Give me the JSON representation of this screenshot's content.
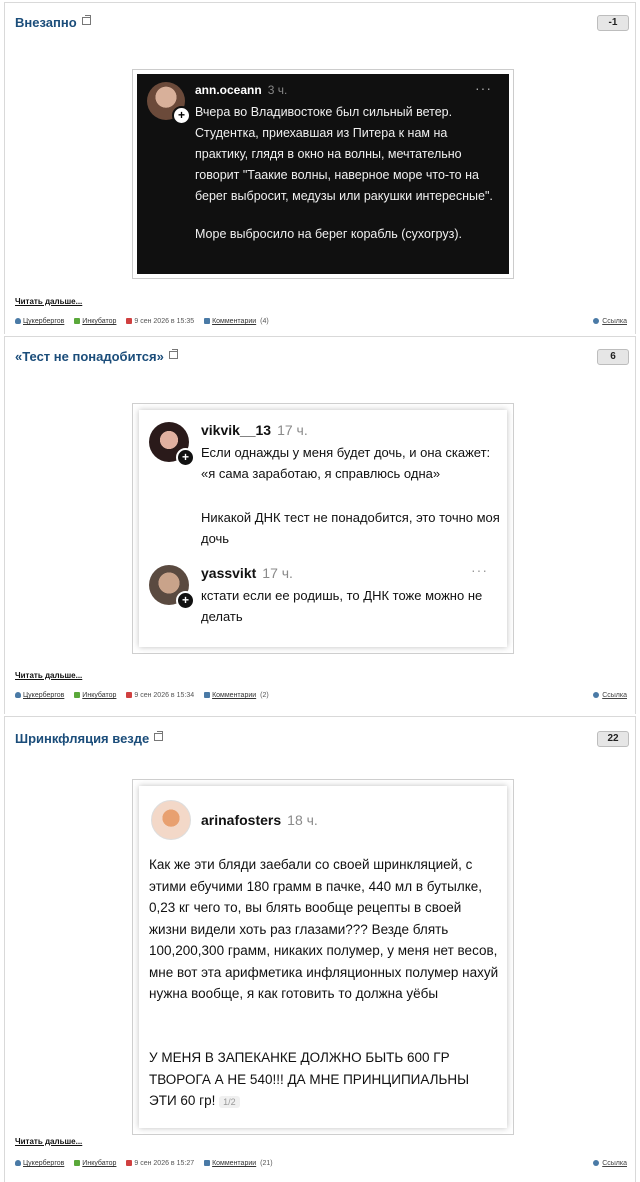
{
  "posts": [
    {
      "title": "Внезапно",
      "score": "-1",
      "comment": {
        "user": "ann.oceann",
        "time": "3 ч.",
        "dots": "···",
        "paragraph1": "Вчера во Владивостоке был сильный ветер. Студентка, приехавшая из Питера к нам на практику, глядя в окно на волны, мечтательно говорит \"Таaкие волны, наверное море что-то на берег выбросит, медузы или ракушки интересные\".",
        "paragraph2": "Море выбросило на берег корабль (сухогруз)."
      },
      "read_more": "Читать дальше...",
      "author": "Цукербергов",
      "section": "Инкубатор",
      "date": "9 сен 2026 в 15:35",
      "comments": "Комментарии",
      "comments_count": "(4)",
      "share": "Ссылка"
    },
    {
      "title": "«Тест не понадобится»",
      "score": "6",
      "comment1": {
        "user": "vikvik__13",
        "time": "17 ч.",
        "text1": "Если однажды у меня будет дочь, и она скажет: «я сама заработаю, я справлюсь одна»",
        "text2": "Никакой ДНК тест не понадобится, это точно моя дочь"
      },
      "comment2": {
        "user": "yassvikt",
        "time": "17 ч.",
        "dots": "···",
        "text": "кстати если ее родишь, то ДНК тоже можно не делать"
      },
      "read_more": "Читать дальше...",
      "author": "Цукербергов",
      "section": "Инкубатор",
      "date": "9 сен 2026 в 15:34",
      "comments": "Комментарии",
      "comments_count": "(2)",
      "share": "Ссылка"
    },
    {
      "title": "Шринкфляция везде",
      "score": "22",
      "comment": {
        "user": "arinafosters",
        "time": "18 ч.",
        "text": "Как же эти бляди заебали со своей шринкляцией, с этими ебучими 180 грамм в пачке, 440 мл в бутылке, 0,23 кг чего то, вы блять вообще рецепты в своей жизни видели хоть раз глазами??? Везде блять 100,200,300 грамм, никаких полумер, у меня нет весов, мне вот эта арифметика инфляционных полумер нахуй нужна вообще, я как готовить то должна уёбы",
        "caps": "У МЕНЯ В ЗАПЕКАНКЕ ДОЛЖНО БЫТЬ 600 ГР ТВОРОГА А НЕ 540!!! ДА МНЕ ПРИНЦИПИАЛЬНЫ ЭТИ 60 гр!",
        "page": "1/2"
      },
      "read_more": "Читать дальше...",
      "author": "Цукербергов",
      "section": "Инкубатор",
      "date": "9 сен 2026 в 15:27",
      "comments": "Комментарии",
      "comments_count": "(21)",
      "share": "Ссылка"
    }
  ],
  "icons": {
    "author": "user-icon",
    "section": "arrow-icon",
    "date": "calendar-icon",
    "comments": "comments-icon",
    "share": "share-icon",
    "external": "external-link-icon"
  },
  "colors": {
    "title": "#1b4d7a",
    "dark_card": "#101010",
    "author_icon": "#4a7aa6",
    "section_icon": "#5aa83a",
    "date_icon": "#d04040",
    "comments_icon": "#4a7aa6"
  }
}
